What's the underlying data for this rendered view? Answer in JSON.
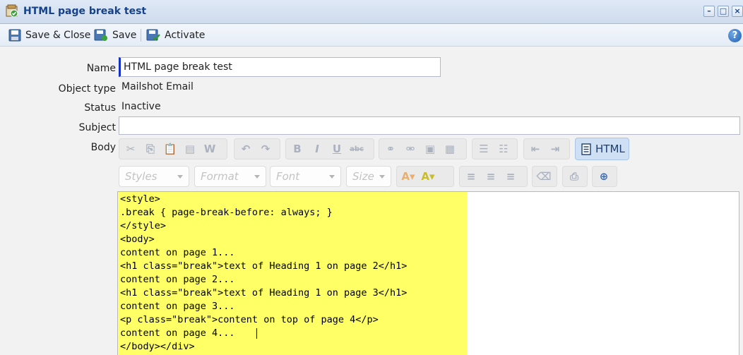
{
  "window": {
    "title": "HTML page break test"
  },
  "toolbar": {
    "save_close_label": "Save & Close",
    "save_label": "Save",
    "activate_label": "Activate",
    "help_label": "?"
  },
  "form": {
    "name_label": "Name",
    "name_value": "HTML page break test",
    "object_type_label": "Object type",
    "object_type_value": "Mailshot Email",
    "status_label": "Status",
    "status_value": "Inactive",
    "subject_label": "Subject",
    "subject_value": "",
    "body_label": "Body"
  },
  "editor": {
    "html_button_label": "HTML",
    "styles_placeholder": "Styles",
    "format_placeholder": "Format",
    "font_placeholder": "Font",
    "size_placeholder": "Size",
    "lines": [
      "<style>",
      ".break { page-break-before: always; }",
      "</style>",
      "<body>",
      "content on page 1...",
      "<h1 class=\"break\">text of Heading 1 on page 2</h1>",
      "content on page 2...",
      "<h1 class=\"break\">text of Heading 1 on page 3</h1>",
      "content on page 3...",
      "<p class=\"break\">content on top of page 4</p>",
      "content on page 4...",
      "</body></div>"
    ]
  },
  "colors": {
    "titlebar_text": "#15428b",
    "code_highlight": "#ffff66",
    "name_focus_bar": "#1530c9"
  }
}
